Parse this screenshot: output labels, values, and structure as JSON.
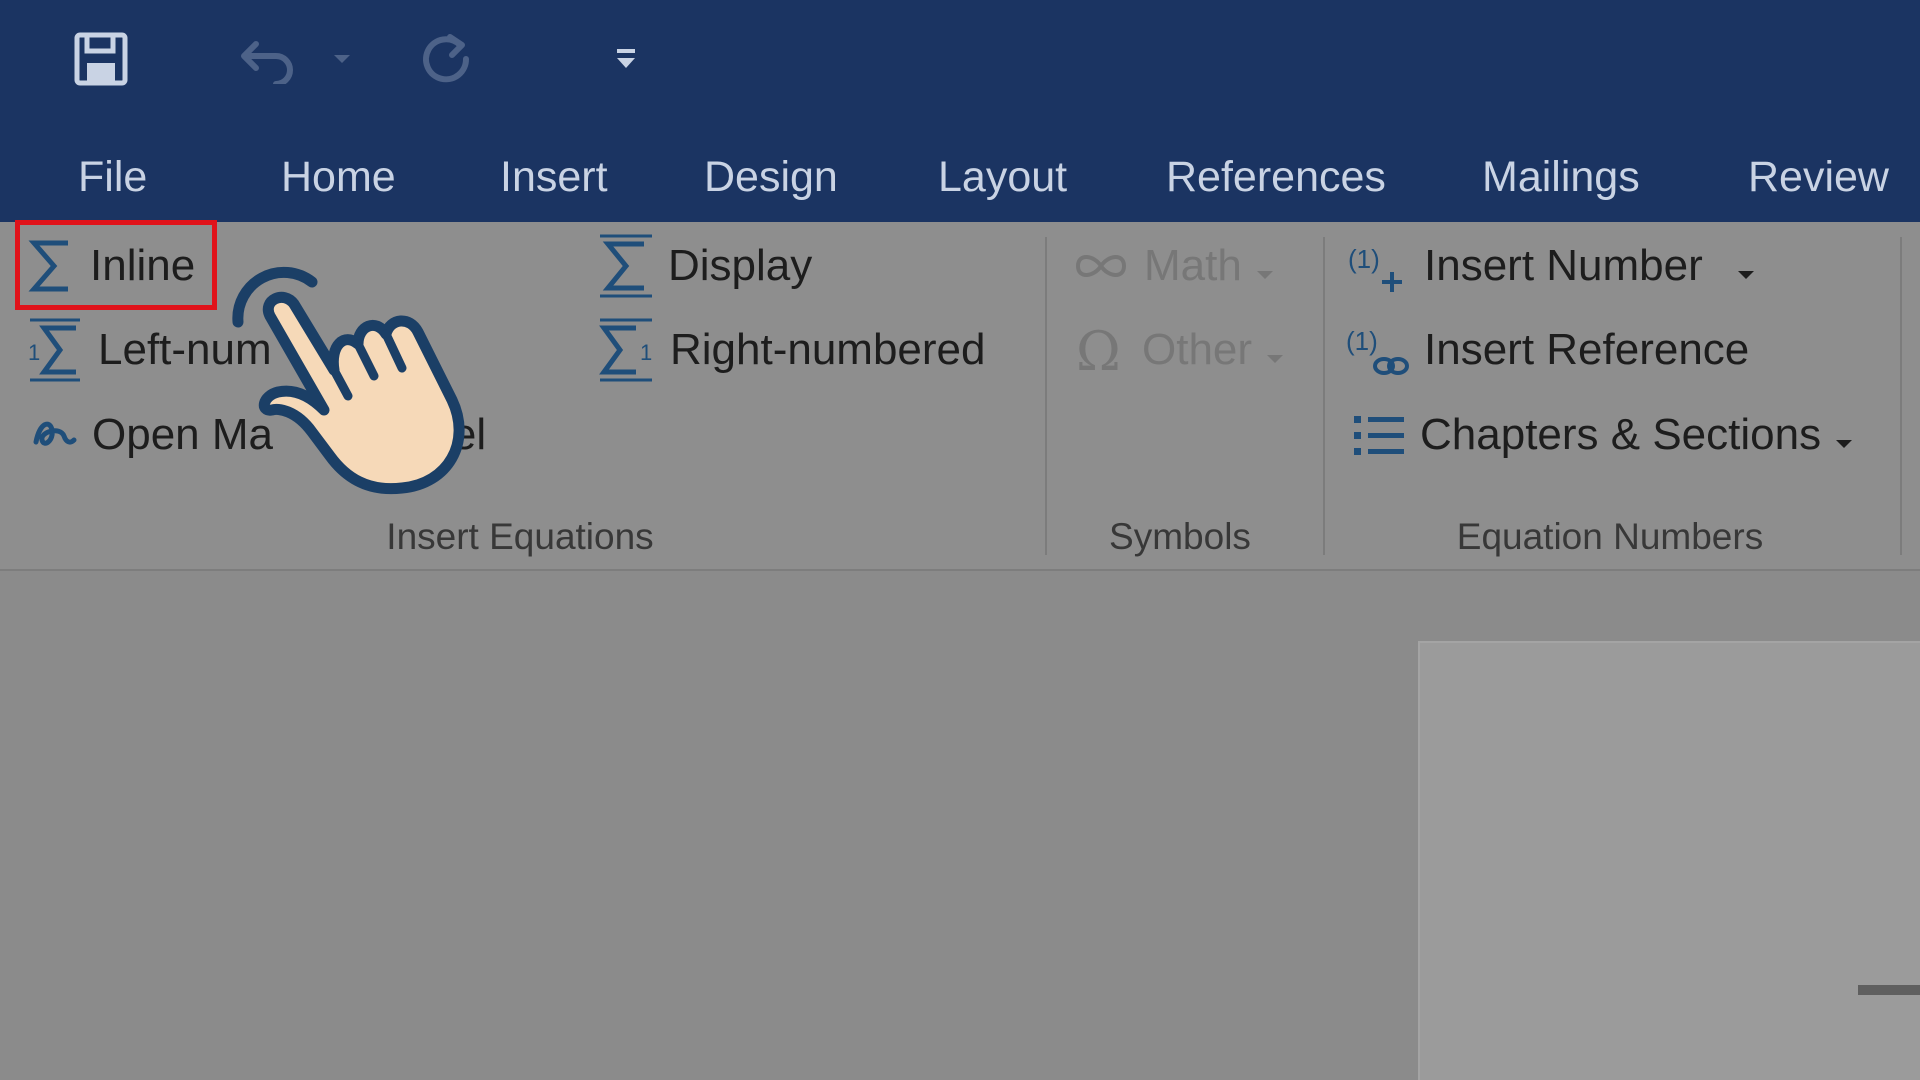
{
  "quick_access": {
    "save_icon": "save-icon",
    "undo_icon": "undo-icon",
    "redo_icon": "redo-icon",
    "customize_icon": "customize-qat-icon"
  },
  "tabs": [
    {
      "label": "File"
    },
    {
      "label": "Home"
    },
    {
      "label": "Insert"
    },
    {
      "label": "Design"
    },
    {
      "label": "Layout"
    },
    {
      "label": "References"
    },
    {
      "label": "Mailings"
    },
    {
      "label": "Review"
    }
  ],
  "ribbon": {
    "insert_equations": {
      "label": "Insert Equations",
      "inline": "Inline",
      "left_numbered": "Left-num",
      "open_math_panel_start": "Open Ma",
      "open_math_panel_end": "anel",
      "display": "Display",
      "right_numbered": "Right-numbered"
    },
    "symbols": {
      "label": "Symbols",
      "math": "Math",
      "other": "Other"
    },
    "equation_numbers": {
      "label": "Equation Numbers",
      "insert_number": "Insert Number",
      "insert_reference": "Insert Reference",
      "chapters_sections": "Chapters & Sections"
    }
  },
  "colors": {
    "title_bar": "#1b3462",
    "highlight": "#e0121a",
    "hand_fill": "#f6d9b8",
    "hand_outline": "#1b3f66",
    "icon_blue": "#1f4e7a"
  }
}
